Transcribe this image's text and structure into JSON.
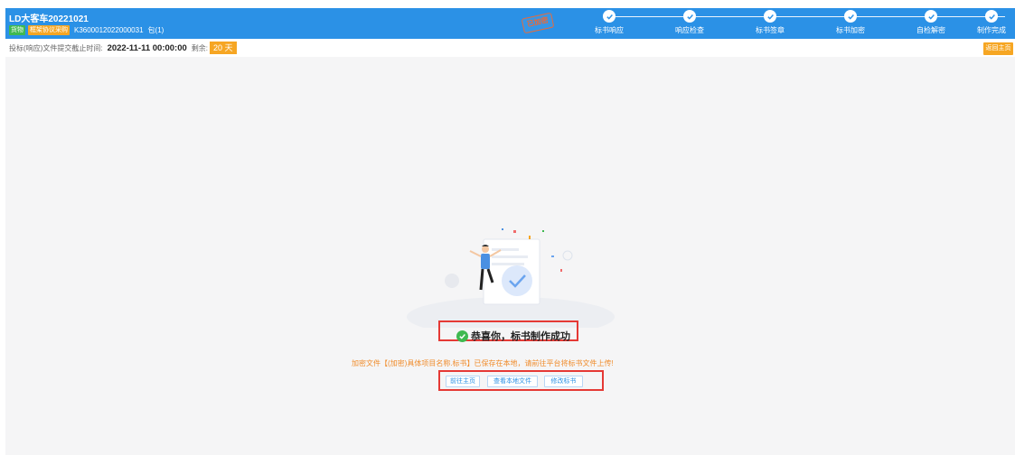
{
  "header": {
    "project_title": "LD大客车20221021",
    "tag_goods": "货物",
    "tag_method": "框架协议采购",
    "project_code": "K3600012022000031",
    "package": "包(1)",
    "stamp": "已加密"
  },
  "steps": [
    {
      "label": "标书响应",
      "done": true
    },
    {
      "label": "响应检查",
      "done": true
    },
    {
      "label": "标书签章",
      "done": true
    },
    {
      "label": "标书加密",
      "done": true
    },
    {
      "label": "自检解密",
      "done": true
    },
    {
      "label": "制作完成",
      "done": true
    }
  ],
  "deadline": {
    "label": "投标(响应)文件提交截止时间:",
    "datetime": "2022-11-11 00:00:00",
    "remain_label": "剩余:",
    "remain_value": "20 天"
  },
  "home_button": "返回主页",
  "result": {
    "success_text": "恭喜你，标书制作成功",
    "notice": "加密文件【(加密)具体项目名称.标书】已保存在本地，请前往平台将标书文件上传!",
    "buttons": [
      "前往主页",
      "查看本地文件",
      "修改标书"
    ]
  },
  "colors": {
    "header_bg": "#2b91e6",
    "accent_orange": "#f6a623",
    "success_green": "#3fb950",
    "highlight_red": "#e53935"
  }
}
